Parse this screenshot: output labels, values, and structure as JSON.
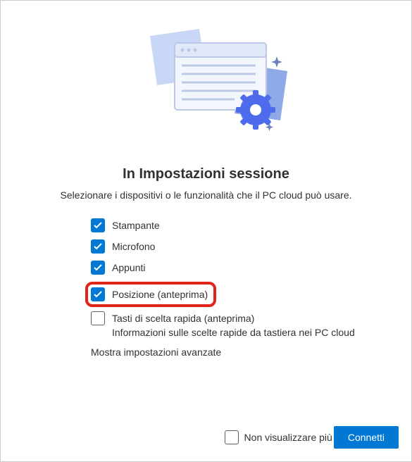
{
  "title": "In Impostazioni sessione",
  "subtitle": "Selezionare i dispositivi o le funzionalità che il PC cloud può usare.",
  "options": {
    "printer": {
      "label": "Stampante",
      "checked": true
    },
    "microphone": {
      "label": "Microfono",
      "checked": true
    },
    "clipboard": {
      "label": "Appunti",
      "checked": true
    },
    "location": {
      "label": "Posizione (anteprima)",
      "checked": true
    },
    "shortcuts": {
      "label": "Tasti di scelta rapida (anteprima)",
      "checked": false,
      "subtext": "Informazioni sulle scelte rapide da tastiera nei PC cloud"
    }
  },
  "advanced_link": "Mostra impostazioni avanzate",
  "footer": {
    "dont_show_label": "Non visualizzare più",
    "dont_show_checked": false,
    "connect_label": "Connetti"
  },
  "colors": {
    "primary": "#0078d4",
    "highlight": "#e2231a"
  }
}
